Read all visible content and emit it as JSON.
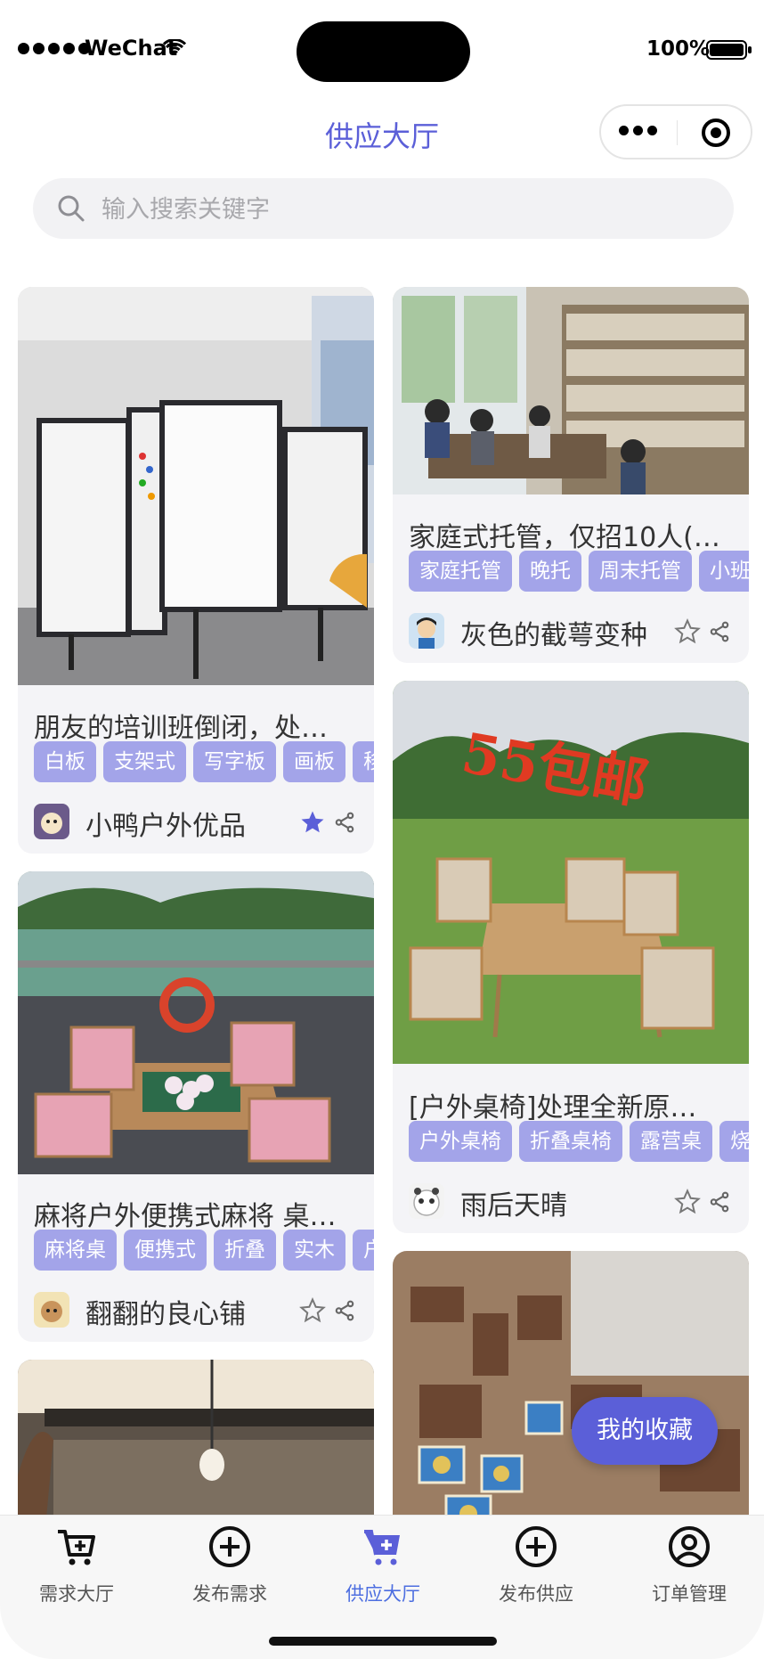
{
  "status_bar": {
    "carrier": "WeChat",
    "battery": "100%"
  },
  "nav": {
    "title": "供应大厅"
  },
  "search": {
    "placeholder": "输入搜索关键字",
    "value": ""
  },
  "cards": [
    {
      "title": "朋友的培训班倒闭，处…",
      "tags": [
        "白板",
        "支架式",
        "写字板",
        "画板",
        "移"
      ],
      "seller": "小鸭户外优品",
      "favorited": true
    },
    {
      "title": "家庭式托管，仅招10人(…",
      "tags": [
        "家庭托管",
        "晚托",
        "周末托管",
        "小班"
      ],
      "seller": "灰色的截萼变种",
      "favorited": false
    },
    {
      "title": "[户外桌椅]处理全新原…",
      "photo_text": "55包邮",
      "tags": [
        "户外桌椅",
        "折叠桌椅",
        "露营桌",
        "烧"
      ],
      "seller": "雨后天晴",
      "favorited": false
    },
    {
      "title": "麻将户外便携式麻将 桌…",
      "tags": [
        "麻将桌",
        "便携式",
        "折叠",
        "实木",
        "户"
      ],
      "seller": "翻翻的良心铺",
      "favorited": false
    }
  ],
  "floating_button": {
    "label": "我的收藏"
  },
  "tab_bar": {
    "active_index": 2,
    "items": [
      {
        "label": "需求大厅",
        "icon": "cart-plus-icon"
      },
      {
        "label": "发布需求",
        "icon": "plus-circle-icon"
      },
      {
        "label": "供应大厅",
        "icon": "cart-plus-icon"
      },
      {
        "label": "发布供应",
        "icon": "plus-circle-icon"
      },
      {
        "label": "订单管理",
        "icon": "user-circle-icon"
      }
    ]
  },
  "colors": {
    "accent": "#5b5fd8",
    "tag_bg": "#a3a4e9",
    "tab_active": "#4d6ee0",
    "card_bg": "#f4f4f7"
  }
}
